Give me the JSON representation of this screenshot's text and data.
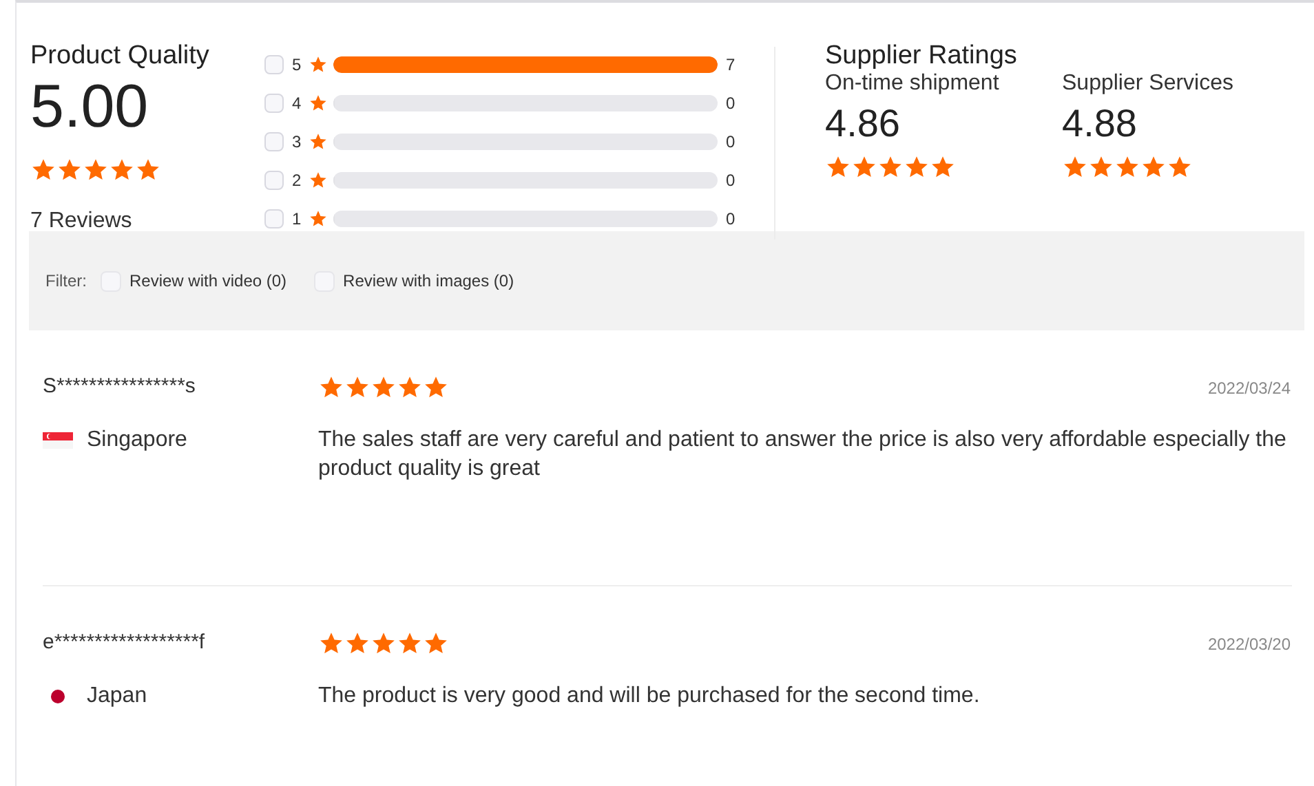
{
  "product_quality": {
    "title": "Product Quality",
    "score": "5.00",
    "stars": 5,
    "reviews": "7 Reviews"
  },
  "breakdown": [
    {
      "rating": "5",
      "checked": false,
      "level": 1,
      "count": "7"
    },
    {
      "rating": "4",
      "checked": false,
      "level": 0,
      "count": "0"
    },
    {
      "rating": "3",
      "checked": false,
      "level": 0,
      "count": "0"
    },
    {
      "rating": "2",
      "checked": false,
      "level": 0,
      "count": "0"
    },
    {
      "rating": "1",
      "checked": false,
      "level": 0,
      "count": "0"
    }
  ],
  "supplier_ratings": {
    "title": "Supplier Ratings",
    "items": [
      {
        "label": "On-time shipment",
        "score": "4.86",
        "stars": 5
      },
      {
        "label": "Supplier Services",
        "score": "4.88",
        "stars": 5
      }
    ]
  },
  "filter": {
    "label": "Filter:",
    "options": [
      {
        "label": "Review with video (0)",
        "checked": false
      },
      {
        "label": "Review with images (0)",
        "checked": false
      }
    ]
  },
  "reviews": [
    {
      "name": "S****************s",
      "country": "Singapore",
      "kind": "sg",
      "stars": 5,
      "date": "2022/03/24",
      "text": "The sales staff are very careful and patient to answer the price is also very affordable especially the product quality is great"
    },
    {
      "name": "e******************f",
      "country": "Japan",
      "kind": "jp",
      "stars": 5,
      "date": "2022/03/20",
      "text": "The product is very good and will be purchased for the second time."
    }
  ]
}
